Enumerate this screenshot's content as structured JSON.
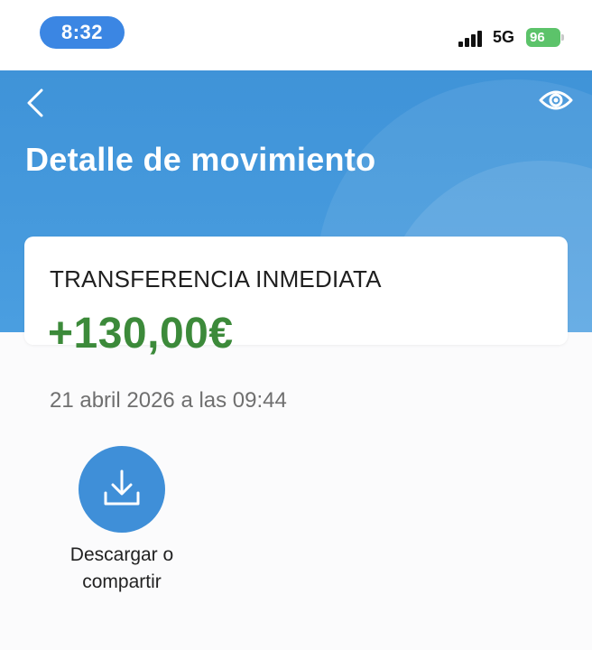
{
  "status_bar": {
    "time": "8:32",
    "network": "5G",
    "battery": "96"
  },
  "header": {
    "title": "Detalle de movimiento",
    "back_icon": "chevron-left-icon",
    "eye_icon": "eye-icon",
    "background_color": "#3f93d8"
  },
  "movement": {
    "type": "TRANSFERENCIA INMEDIATA",
    "amount": "+130,00€",
    "amount_color": "#3c8a3a",
    "datetime": "21 abril 2026 a las 09:44"
  },
  "actions": {
    "download_label": "Descargar o compartir",
    "download_icon": "download-icon"
  }
}
